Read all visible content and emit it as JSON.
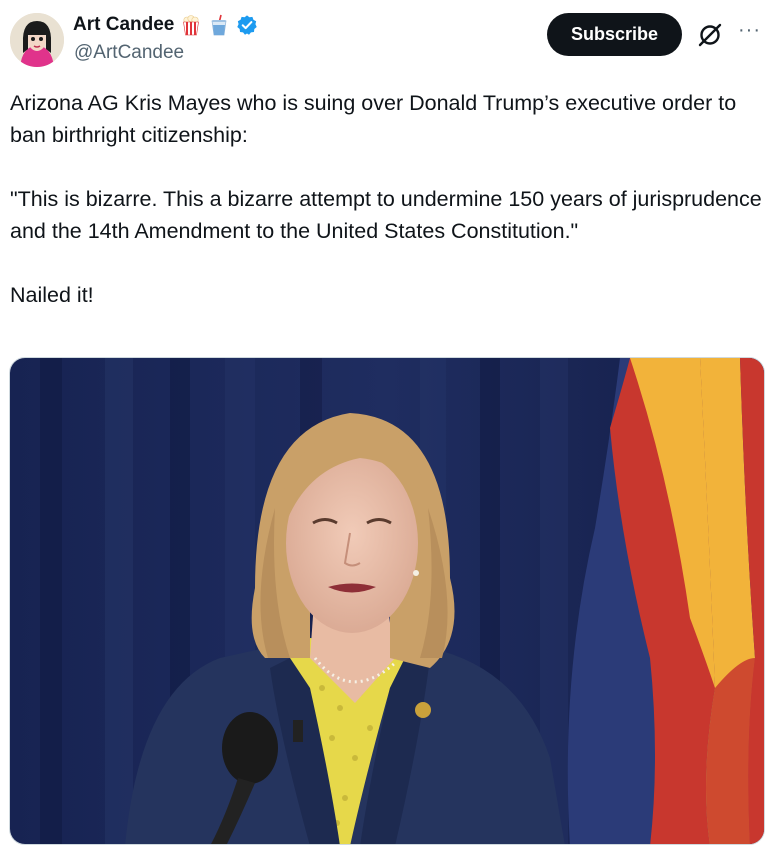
{
  "author": {
    "name": "Art Candee",
    "handle": "@ArtCandee",
    "badges": [
      "popcorn-icon",
      "drink-icon",
      "verified-badge-icon"
    ]
  },
  "actions": {
    "subscribe_label": "Subscribe",
    "grok_icon": "grok-icon",
    "more_icon": "more-icon"
  },
  "tweet": {
    "line1": "Arizona AG Kris Mayes who is suing over Donald Trump’s executive order to ban birthright citizenship:",
    "quote": "\"This is bizarre. This a bizarre attempt to undermine 150 years of jurisprudence and the 14th Amendment to the United States Constitution.\"",
    "closing": "Nailed it!"
  },
  "media": {
    "type": "video-still",
    "colors": {
      "curtain": "#1c2a5a",
      "flag_red": "#c8372e",
      "flag_yellow": "#f2b33a",
      "flag_blue": "#2b3b78",
      "jacket": "#25345e",
      "blouse": "#e6d84a",
      "hair": "#c9a068"
    }
  },
  "colors": {
    "text": "#0f1419",
    "secondary": "#536471",
    "verified": "#1d9bf0",
    "button_bg": "#0f1419"
  }
}
